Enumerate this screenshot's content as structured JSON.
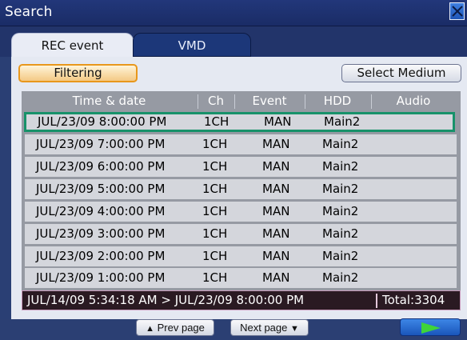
{
  "window": {
    "title": "Search",
    "close_icon": "close-x-icon"
  },
  "tabs": [
    {
      "label": "REC event",
      "active": true
    },
    {
      "label": "VMD",
      "active": false
    }
  ],
  "toolbar": {
    "filter_label": "Filtering",
    "medium_label": "Select Medium"
  },
  "table": {
    "headers": [
      "Time & date",
      "Ch",
      "Event",
      "HDD",
      "Audio"
    ],
    "rows": [
      {
        "time": "JUL/23/09  8:00:00 PM",
        "ch": "1CH",
        "event": "MAN",
        "hdd": "Main2",
        "audio": "",
        "selected": true
      },
      {
        "time": "JUL/23/09  7:00:00 PM",
        "ch": "1CH",
        "event": "MAN",
        "hdd": "Main2",
        "audio": ""
      },
      {
        "time": "JUL/23/09  6:00:00 PM",
        "ch": "1CH",
        "event": "MAN",
        "hdd": "Main2",
        "audio": ""
      },
      {
        "time": "JUL/23/09  5:00:00 PM",
        "ch": "1CH",
        "event": "MAN",
        "hdd": "Main2",
        "audio": ""
      },
      {
        "time": "JUL/23/09  4:00:00 PM",
        "ch": "1CH",
        "event": "MAN",
        "hdd": "Main2",
        "audio": ""
      },
      {
        "time": "JUL/23/09  3:00:00 PM",
        "ch": "1CH",
        "event": "MAN",
        "hdd": "Main2",
        "audio": ""
      },
      {
        "time": "JUL/23/09  2:00:00 PM",
        "ch": "1CH",
        "event": "MAN",
        "hdd": "Main2",
        "audio": ""
      },
      {
        "time": "JUL/23/09  1:00:00 PM",
        "ch": "1CH",
        "event": "MAN",
        "hdd": "Main2",
        "audio": ""
      }
    ]
  },
  "status": {
    "range": "JUL/14/09  5:34:18 AM > JUL/23/09  8:00:00 PM",
    "total": "Total:3304"
  },
  "pager": {
    "prev_label": "Prev page",
    "next_label": "Next page",
    "prev_icon": "triangle-up-icon",
    "next_icon": "triangle-down-icon",
    "go_icon": "play-arrow-icon"
  },
  "colors": {
    "selection": "#17926a",
    "filter_border": "#e8971c",
    "play_arrow": "#3fd43a"
  }
}
